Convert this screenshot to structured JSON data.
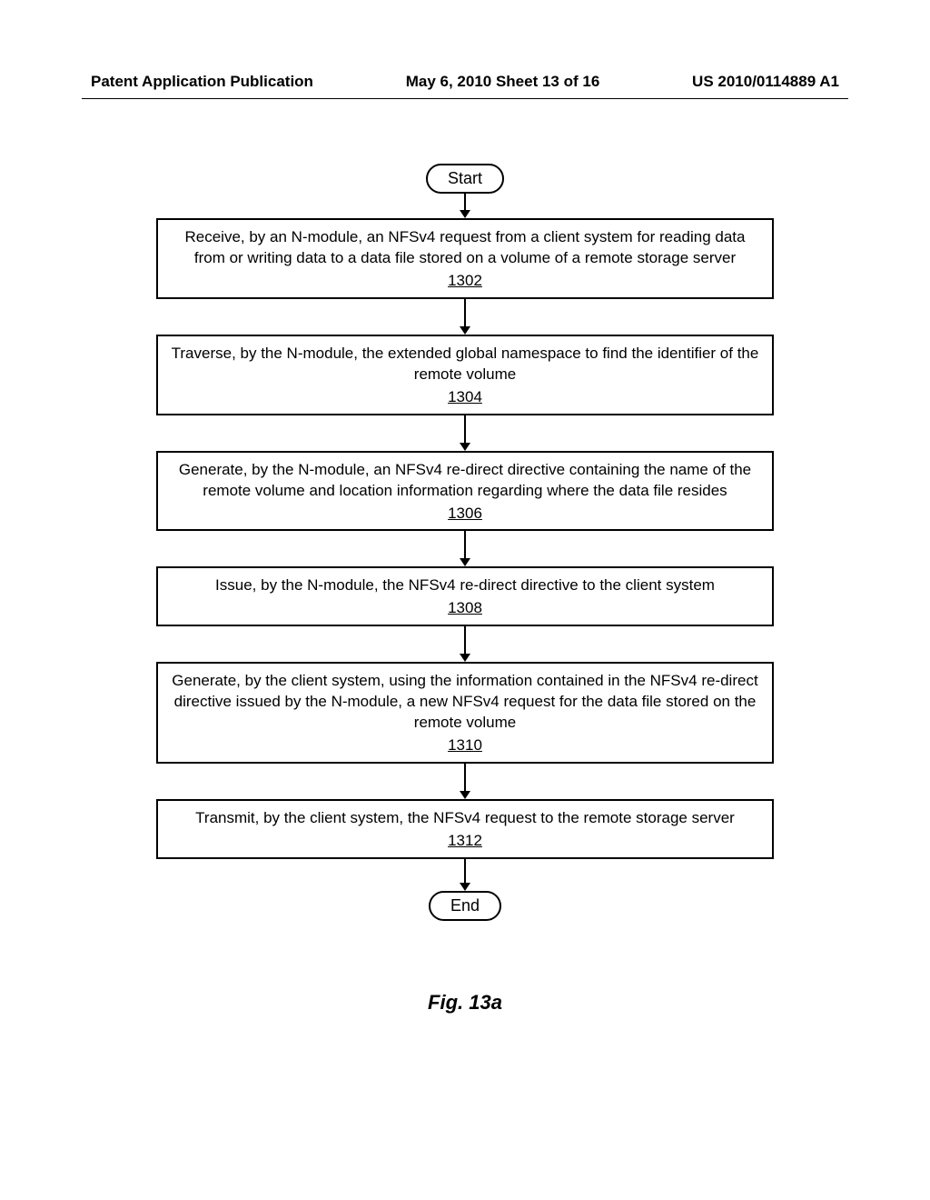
{
  "header": {
    "left": "Patent Application Publication",
    "center": "May 6, 2010  Sheet 13 of 16",
    "right": "US 2010/0114889 A1"
  },
  "flow": {
    "start": "Start",
    "end": "End",
    "steps": [
      {
        "text": "Receive, by an N-module, an NFSv4 request from a client system for reading data from or writing data to a data file stored on a volume of a remote storage server",
        "num": "1302"
      },
      {
        "text": "Traverse, by the N-module, the extended global namespace to find the identifier of the remote volume",
        "num": "1304"
      },
      {
        "text": "Generate, by the N-module, an NFSv4 re-direct directive containing the name of the remote volume and location information regarding where the data file resides",
        "num": "1306"
      },
      {
        "text": "Issue, by the N-module, the NFSv4 re-direct directive to the client system",
        "num": "1308"
      },
      {
        "text": "Generate, by the client system, using the information contained in the NFSv4 re-direct directive issued by the N-module, a new NFSv4 request for the data file stored on the remote volume",
        "num": "1310"
      },
      {
        "text": "Transmit, by the client system, the NFSv4 request to the remote storage server",
        "num": "1312"
      }
    ]
  },
  "caption": "Fig. 13a",
  "arrow_heights": {
    "first": 36,
    "between": 30,
    "last": 26
  }
}
